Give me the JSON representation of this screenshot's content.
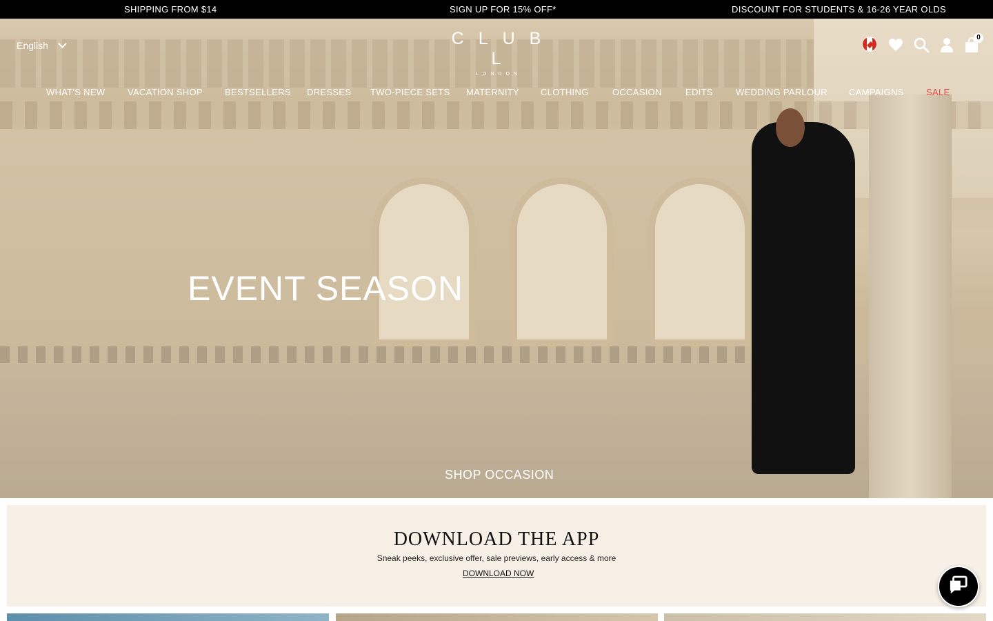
{
  "announcement": {
    "shipping": "SHIPPING FROM $14",
    "signup": "SIGN UP FOR 15% OFF*",
    "students": "DISCOUNT FOR STUDENTS & 16-26 YEAR OLDS"
  },
  "header": {
    "language": "English",
    "logo_main": "CLUB L",
    "logo_sub": "LONDON",
    "cart_count": "0",
    "icons": [
      "canada-flag-icon",
      "heart-icon",
      "search-icon",
      "account-icon",
      "bag-icon"
    ]
  },
  "nav": {
    "items": [
      "WHAT'S NEW",
      "VACATION SHOP",
      "BESTSELLERS",
      "DRESSES",
      "TWO-PIECE SETS",
      "MATERNITY",
      "CLOTHING",
      "OCCASION",
      "EDITS",
      "WEDDING PARLOUR",
      "CAMPAIGNS",
      "SALE"
    ]
  },
  "hero": {
    "title": "EVENT SEASON",
    "cta": "SHOP OCCASION"
  },
  "app_banner": {
    "title": "DOWNLOAD THE APP",
    "subtitle": "Sneak peeks, exclusive offer, sale previews, early access & more",
    "link": "DOWNLOAD NOW"
  },
  "colors": {
    "announcement_bg": "#000000",
    "sale": "#e34b4b",
    "banner_bg": "#f6f0e6"
  }
}
